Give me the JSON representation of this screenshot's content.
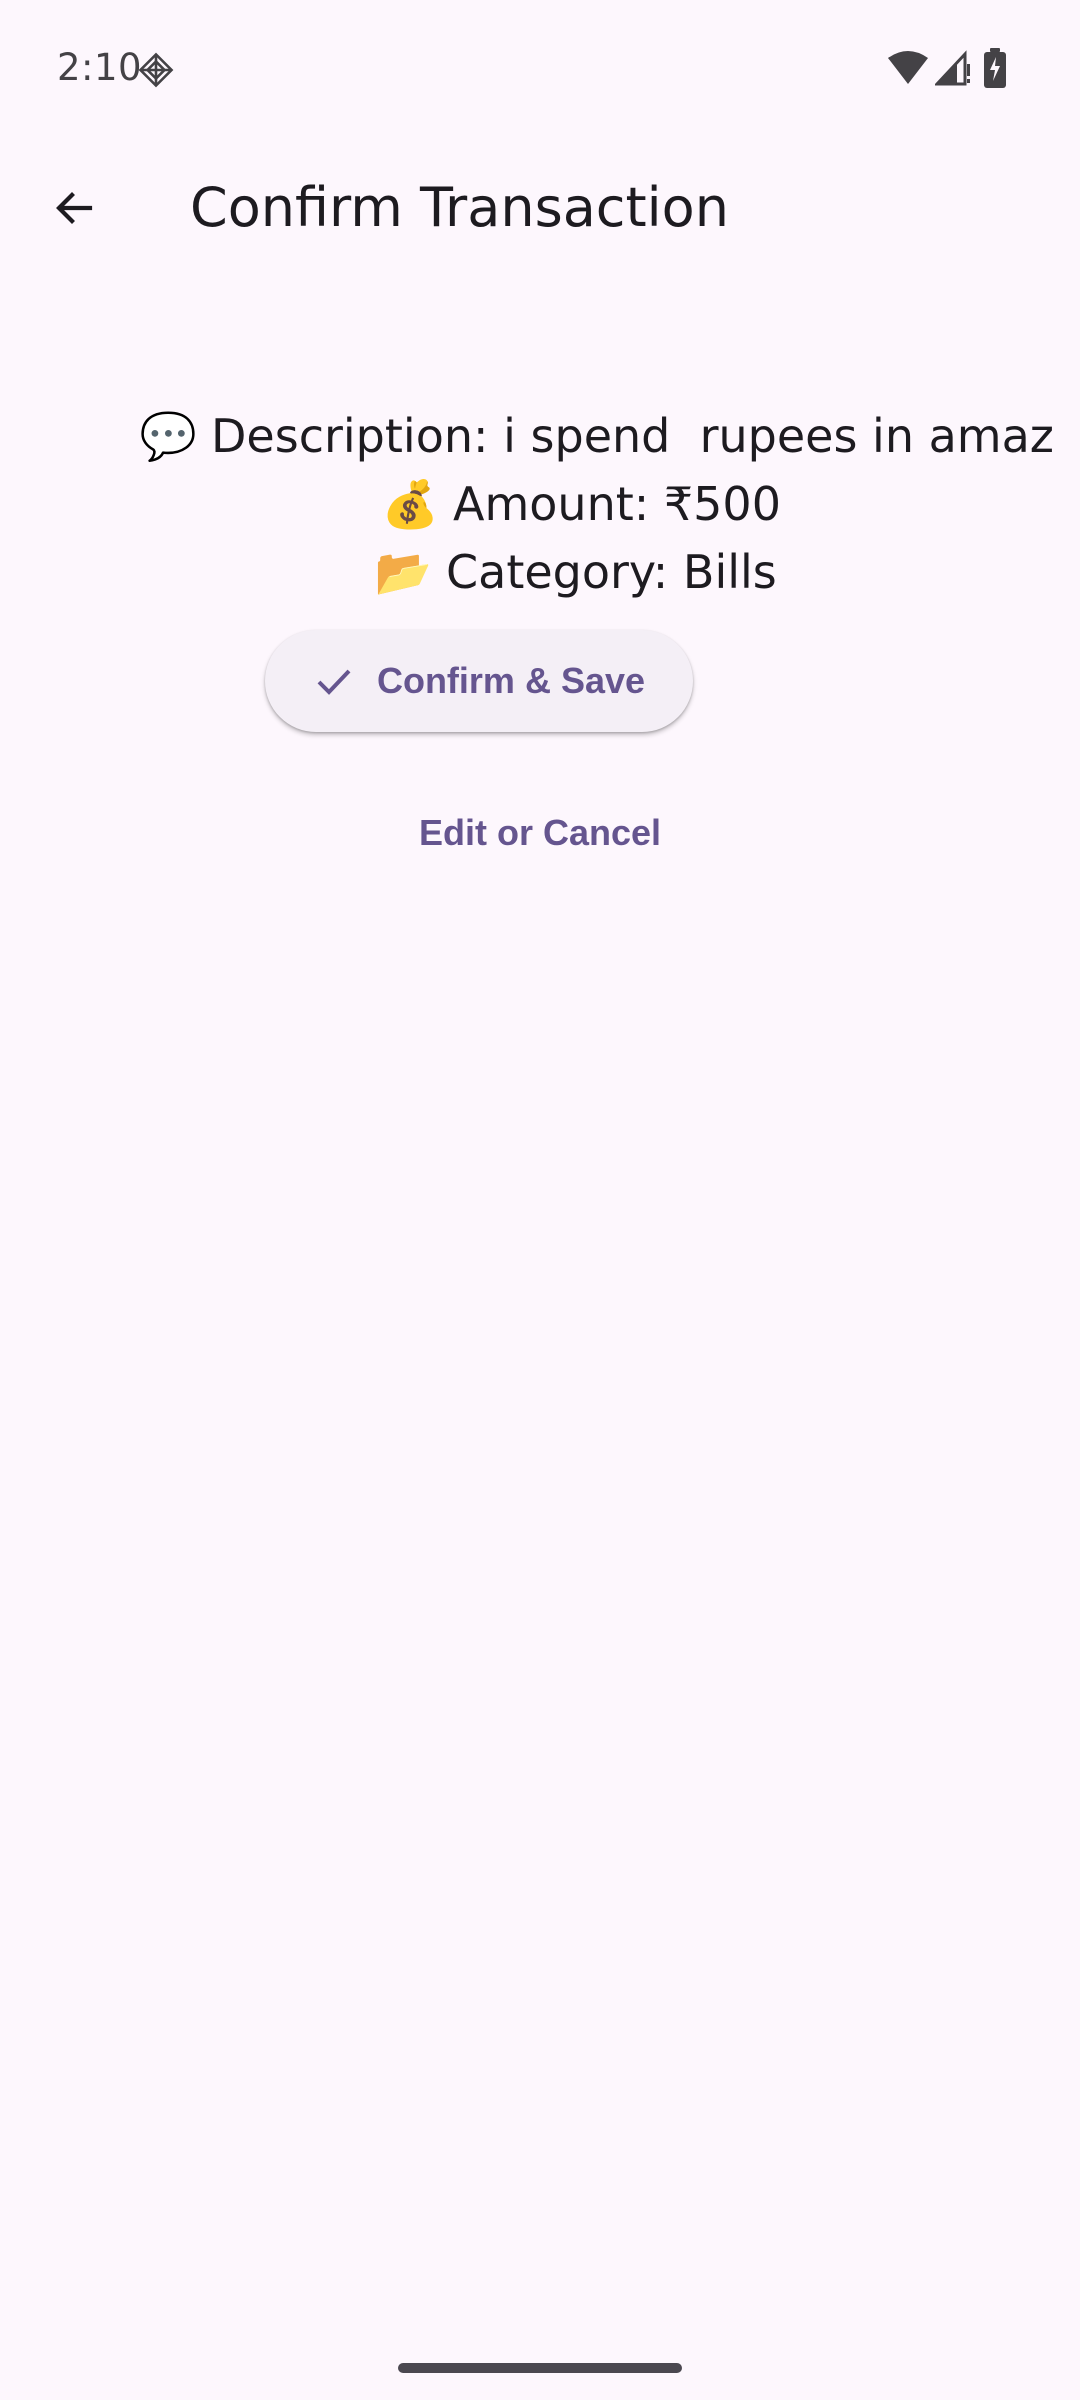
{
  "status_bar": {
    "time": "2:10",
    "icons": [
      "app-notification-icon",
      "wifi-icon",
      "signal-icon",
      "battery-charging-icon"
    ]
  },
  "app_bar": {
    "title": "Confirm Transaction",
    "back_icon": "arrow-back-icon"
  },
  "details": {
    "description": {
      "emoji": "💬",
      "text": "Description: i spend  rupees in amaz"
    },
    "amount": {
      "emoji": "💰",
      "text": "Amount: ₹500"
    },
    "category": {
      "emoji": "📂",
      "text": "Category: Bills"
    }
  },
  "actions": {
    "confirm_label": "Confirm & Save",
    "confirm_icon": "check-icon",
    "edit_label": "Edit or Cancel"
  },
  "colors": {
    "background": "#FDF7FD",
    "primary": "#65558F",
    "button_surface": "#F4EFF6",
    "text": "#1D1B20"
  }
}
